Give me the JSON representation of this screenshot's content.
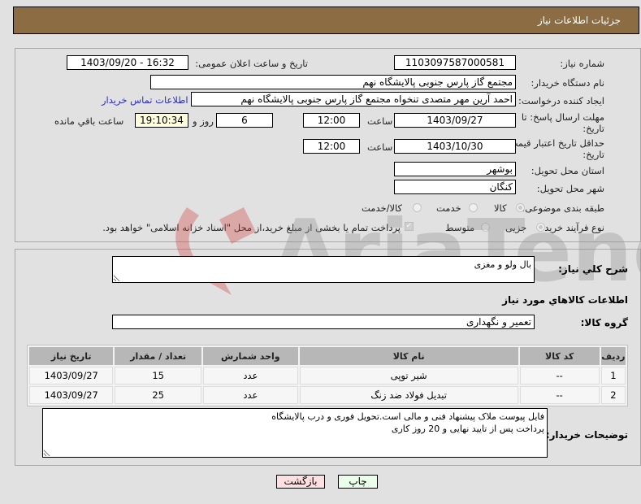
{
  "header": {
    "title": "جزئیات اطلاعات نیاز"
  },
  "fields": {
    "need_number": {
      "label": "شماره نیاز:",
      "value": "1103097587000581"
    },
    "announce_datetime": {
      "label": "تاریخ و ساعت اعلان عمومی:",
      "value": "1403/09/20 - 16:32"
    },
    "buyer_org": {
      "label": "نام دستگاه خریدار:",
      "value": "مجتمع گاز پارس جنوبی  پالایشگاه نهم"
    },
    "requester": {
      "label": "ایجاد کننده درخواست:",
      "value": "احمد آرین مهر متصدی تنخواه مجتمع گاز پارس جنوبی  پالایشگاه نهم",
      "contact_link": "اطلاعات تماس خریدار"
    },
    "reply_deadline": {
      "label_line1": "مهلت ارسال پاسخ: تا",
      "label_line2": "تاریخ:",
      "date": "1403/09/27",
      "time_label": "ساعت",
      "time": "12:00",
      "days": "6",
      "days_label": "روز و",
      "remaining": "19:10:34",
      "remaining_label": "ساعت باقي مانده"
    },
    "price_validity": {
      "label_line1": "حداقل تاریخ اعتبار قیمت: تا",
      "label_line2": "تاریخ:",
      "date": "1403/10/30",
      "time_label": "ساعت",
      "time": "12:00"
    },
    "province": {
      "label": "استان محل تحویل:",
      "value": "بوشهر"
    },
    "city": {
      "label": "شهر محل تحویل:",
      "value": "کنگان"
    },
    "category": {
      "label": "طبقه بندی موضوعی:",
      "options": [
        "کالا",
        "خدمت",
        "کالا/خدمت"
      ],
      "selected": "کالا"
    },
    "purchase_type": {
      "label": "نوع فرآیند خرید :",
      "options": [
        "جزیی",
        "متوسط"
      ],
      "selected": "جزیی",
      "treasury_note": "پرداخت تمام یا بخشی از مبلغ خرید،از محل \"اسناد خزانه اسلامی\" خواهد بود.",
      "treasury_checked": true
    }
  },
  "description": {
    "label": "شرح کلي نياز:",
    "value": "بال ولو و مغزی"
  },
  "goods_section": {
    "title": "اطلاعات کالاهاي مورد نياز"
  },
  "goods_group": {
    "label": "گروه کالا:",
    "value": "تعمیر و نگهداری"
  },
  "items_table": {
    "headers": [
      "ردیف",
      "کد کالا",
      "نام کالا",
      "واحد شمارش",
      "تعداد / مقدار",
      "تاریخ نیاز"
    ],
    "rows": [
      [
        "1",
        "--",
        "شیر توپی",
        "عدد",
        "15",
        "1403/09/27"
      ],
      [
        "2",
        "--",
        "تبدیل فولاد ضد زنگ",
        "عدد",
        "25",
        "1403/09/27"
      ]
    ]
  },
  "buyer_notes": {
    "label": "توضیحات خریدار:",
    "value": "فایل پیوست ملاک پیشنهاد فنی و مالی است.تحویل فوری و درب پالایشگاه\nپرداخت پس از تایید نهایی و 20 روز کاری"
  },
  "buttons": {
    "print": "چاپ",
    "back": "بازگشت"
  },
  "watermark": {
    "text": "AriaTender.net"
  },
  "colors": {
    "header_bg": "#8c6c42",
    "print_bg": "#eaffea",
    "back_bg": "#ffe0e0",
    "link": "#2b2bd0"
  }
}
